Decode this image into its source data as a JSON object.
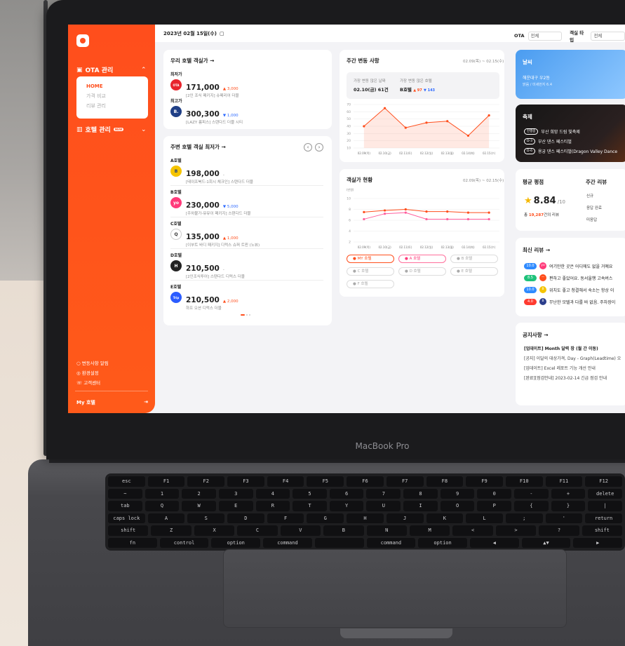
{
  "laptop": {
    "brand": "MacBook Pro"
  },
  "keyboard": {
    "rows": [
      [
        "esc",
        "F1",
        "F2",
        "F3",
        "F4",
        "F5",
        "F6",
        "F7",
        "F8",
        "F9",
        "F10",
        "F11",
        "F12"
      ],
      [
        "~",
        "1",
        "2",
        "3",
        "4",
        "5",
        "6",
        "7",
        "8",
        "9",
        "0",
        "-",
        "+",
        "delete"
      ],
      [
        "tab",
        "Q",
        "W",
        "E",
        "R",
        "T",
        "Y",
        "U",
        "I",
        "O",
        "P",
        "{",
        "}",
        "|"
      ],
      [
        "caps lock",
        "A",
        "S",
        "D",
        "F",
        "G",
        "H",
        "J",
        "K",
        "L",
        ";",
        "'",
        "return"
      ],
      [
        "shift",
        "Z",
        "X",
        "C",
        "V",
        "B",
        "N",
        "M",
        "<",
        ">",
        "?",
        "shift"
      ],
      [
        "fn",
        "control",
        "option",
        "command",
        "",
        "command",
        "option",
        "◀",
        "▲▼",
        "▶"
      ]
    ]
  },
  "sidebar": {
    "ota_menu": "OTA 관리",
    "submenu": [
      "HOME",
      "가격 비교",
      "리뷰 관리"
    ],
    "hotel_menu": "호텔 관리",
    "hotel_badge": "NEW",
    "footer": [
      "변동사항 알림",
      "환경설정",
      "고객센터"
    ],
    "my_hotel": "My 호텔",
    "logout_icon": "logout-icon"
  },
  "topbar": {
    "date": "2023년 02월 15일(수)",
    "ota_label": "OTA",
    "ota_value": "전체",
    "room_label": "객실 타입",
    "room_value": "전체"
  },
  "my_rates": {
    "title": "우리 호텔 객실가 →",
    "low_label": "최저가",
    "low_price": "171,000",
    "low_change": "▲ 3,000",
    "low_desc": "[2인 조식 패키지] 슈페리어 더블",
    "high_label": "최고가",
    "high_price": "300,300",
    "high_change": "▼ 1,000",
    "high_desc": "[LAZY 룸피스] 스탠다드 더블 시티"
  },
  "nearby": {
    "title": "주변 호텔 객실 최저가 →",
    "hotels": [
      {
        "name": "A호텔",
        "price": "198,000",
        "change": "-",
        "desc": "[테이프북드-1회시 체크인] 스탠다드 더블",
        "icon": "B",
        "color": "#f5c400"
      },
      {
        "name": "B호텔",
        "price": "230,000",
        "change": "▼ 5,000",
        "desc": "[주차불가-뮤뮤이 패키지] 스탠다드 더블",
        "icon": "yo",
        "color": "#ff3a7a"
      },
      {
        "name": "C호텔",
        "price": "135,000",
        "change": "▲ 1,000",
        "desc": "[이부트 바디 패키지] 디럭스 슈퍼 트윈 (노뷰)",
        "icon": "Q",
        "color": "#ffffff"
      },
      {
        "name": "D호텔",
        "price": "210,500",
        "change": "-",
        "desc": "[2인조식투어] 스탠다드 디럭스 더블",
        "icon": "H",
        "color": "#222222"
      },
      {
        "name": "E호텔",
        "price": "210,500",
        "change": "▲ 2,000",
        "desc": "하프 오션 디럭스 더블",
        "icon": "Trip",
        "color": "#2b5cff"
      }
    ]
  },
  "weekly_changes": {
    "title": "주간 변동 사항",
    "range": "02.09(목) ~ 02.15(수)",
    "most_day_label": "가장 변동 많은 날짜",
    "most_day_value": "02.10(금) 61건",
    "most_hotel_label": "가장 변동 많은 호텔",
    "most_hotel_value": "B호텔",
    "most_hotel_up": "▲ 97",
    "most_hotel_down": "▼ 143"
  },
  "rate_status": {
    "title": "객실가 현황",
    "range": "02.09(목) ~ 02.15(수)",
    "unit": "(만원)",
    "legend": [
      "MY 호텔",
      "A 호텔",
      "B 호텔",
      "C 호텔",
      "D 호텔",
      "E 호텔",
      "F 호텔"
    ]
  },
  "chart_data": [
    {
      "type": "line",
      "title": "주간 변동 사항",
      "x": [
        "02.09(목)",
        "02.10(금)",
        "02.11(토)",
        "02.12(일)",
        "02.13(월)",
        "02.14(화)",
        "02.15(수)"
      ],
      "series": [
        {
          "values": [
            40,
            65,
            38,
            45,
            47,
            27,
            55
          ]
        }
      ],
      "ylim": [
        10,
        70
      ],
      "yticks": [
        10,
        20,
        30,
        40,
        50,
        60,
        70
      ],
      "color": "#ff4e1c"
    },
    {
      "type": "line",
      "title": "객실가 현황",
      "x": [
        "02.09(목)",
        "02.10(금)",
        "02.11(토)",
        "02.12(일)",
        "02.13(월)",
        "02.14(화)",
        "02.15(수)"
      ],
      "series": [
        {
          "name": "MY 호텔",
          "values": [
            7.5,
            7.8,
            8.0,
            7.6,
            7.6,
            7.4,
            7.4
          ],
          "color": "#ff4e1c"
        },
        {
          "name": "A 호텔",
          "values": [
            6.2,
            7.2,
            7.4,
            6.2,
            6.2,
            6.2,
            6.2
          ],
          "color": "#ff5f9e"
        }
      ],
      "ylim": [
        2,
        10
      ],
      "yticks": [
        2,
        4,
        6,
        8,
        10
      ]
    }
  ],
  "weather": {
    "title": "날씨",
    "line1": "해운대구 우2동",
    "line2": "맑음 / 미세먼지 6.4"
  },
  "festival": {
    "title": "축제",
    "items": [
      {
        "tag": "진행중",
        "name": "부산 희망 드림 빛축제"
      },
      {
        "tag": "D-3",
        "name": "부산 댄스 페스티벌"
      },
      {
        "tag": "D-6",
        "name": "용궁 댄스 페스티벌(Dragon Valley Dance"
      }
    ]
  },
  "rating": {
    "title": "평균 평점",
    "score": "8.84",
    "max": "/10",
    "count_prefix": "총 ",
    "count": "19,287",
    "count_suffix": "건의 리뷰",
    "weekly_title": "주간 리뷰",
    "weekly_items": [
      "신규",
      "응답 완료",
      "미응답"
    ]
  },
  "reviews": {
    "title": "최신 리뷰 →",
    "items": [
      {
        "score": "10.0",
        "color": "#2f8bff",
        "icon_color": "#ff3a7a",
        "icon": "yo",
        "text": "여기만한 곳은 어디에도 없을 거예요"
      },
      {
        "score": "8.5",
        "color": "#1ec27a",
        "icon_color": "#ff4e1c",
        "icon": "—",
        "text": "편하고 좋았어요. 동서울행 고속버스"
      },
      {
        "score": "10.0",
        "color": "#2f8bff",
        "icon_color": "#f5c400",
        "icon": "B",
        "text": "위치도 좋고 청결해서 숙소는 항상 이"
      },
      {
        "score": "4.0",
        "color": "#ff3b30",
        "icon_color": "#2b3e8c",
        "icon": "B",
        "text": "무난한 모텔과 다를 바 없음. 주차장이"
      }
    ]
  },
  "notice": {
    "title": "공지사항 →",
    "items": [
      "[업데이트] Month 달력 창 (월 간 이동)",
      "[공지] 이달의 대상가격, Day - Graph(Leadtime) 오",
      "[업데이트] Excel 레포트 기능 개선 안내",
      "[완료][점검안내] 2023-02-14 긴급 점검 안내"
    ]
  }
}
